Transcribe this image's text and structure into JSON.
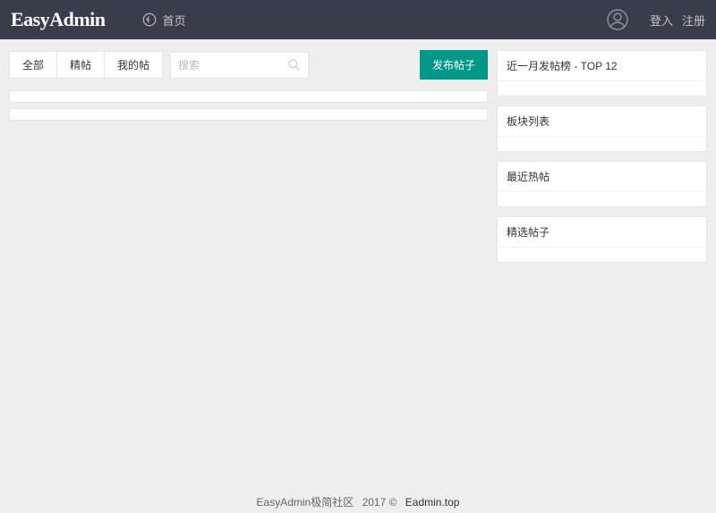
{
  "header": {
    "logo": "EasyAdmin",
    "home_label": "首页",
    "login_label": "登入",
    "register_label": "注册"
  },
  "tabs": {
    "all": "全部",
    "best": "精帖",
    "mine": "我的帖"
  },
  "search": {
    "placeholder": "搜索"
  },
  "publish_label": "发布帖子",
  "sidebar": {
    "top_posters": "近一月发帖榜 - TOP 12",
    "boards": "板块列表",
    "hot": "最近热帖",
    "featured": "精选帖子"
  },
  "footer": {
    "brand": "EasyAdmin极简社区",
    "year": "2017 ©",
    "link": "Eadmin.top"
  }
}
